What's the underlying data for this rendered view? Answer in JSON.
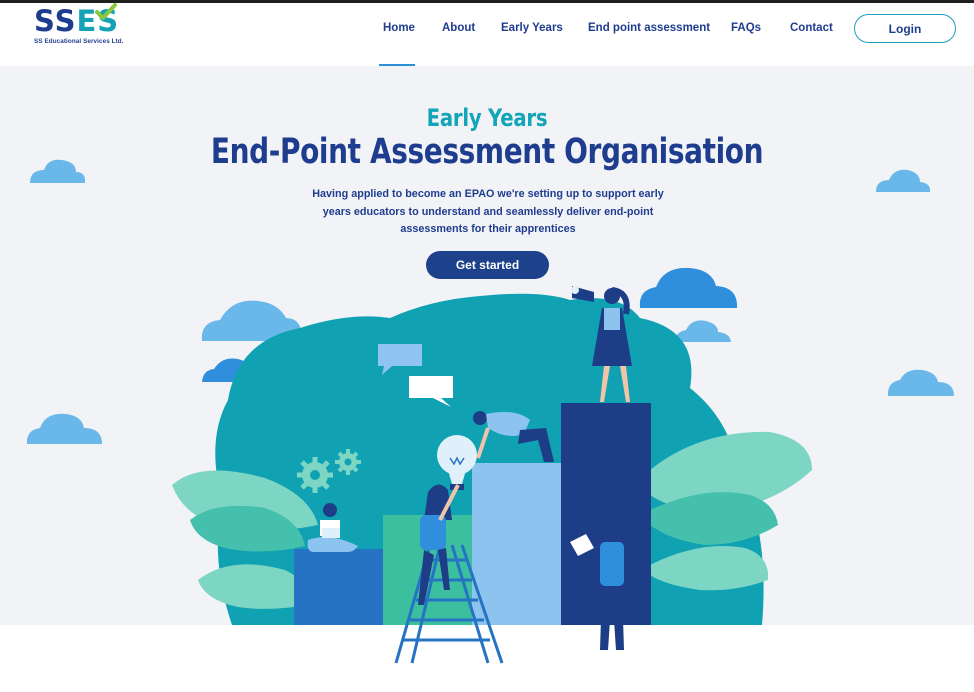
{
  "brand": {
    "logo_text_blue": "SS",
    "logo_text_teal": "ES",
    "company_name": "SS Educational Services Ltd."
  },
  "nav": {
    "items": [
      {
        "label": "Home",
        "active": true
      },
      {
        "label": "About",
        "active": false
      },
      {
        "label": "Early Years",
        "active": false
      },
      {
        "label": "End point assessment",
        "active": false
      },
      {
        "label": "FAQs",
        "active": false
      },
      {
        "label": "Contact",
        "active": false
      }
    ],
    "login_label": "Login"
  },
  "hero": {
    "eyebrow": "Early Years",
    "headline": "End-Point Assessment Organisation",
    "intro": "Having applied to become an EPAO we're setting up to support early years educators to understand and seamlessly deliver end-point assessments for their apprentices",
    "cta_label": "Get started"
  },
  "colors": {
    "navy": "#1f3d8f",
    "teal": "#12a4b8",
    "cta": "#1d418a",
    "hero_bg": "#f2f3f7",
    "cloud": "#6ab7ea"
  }
}
